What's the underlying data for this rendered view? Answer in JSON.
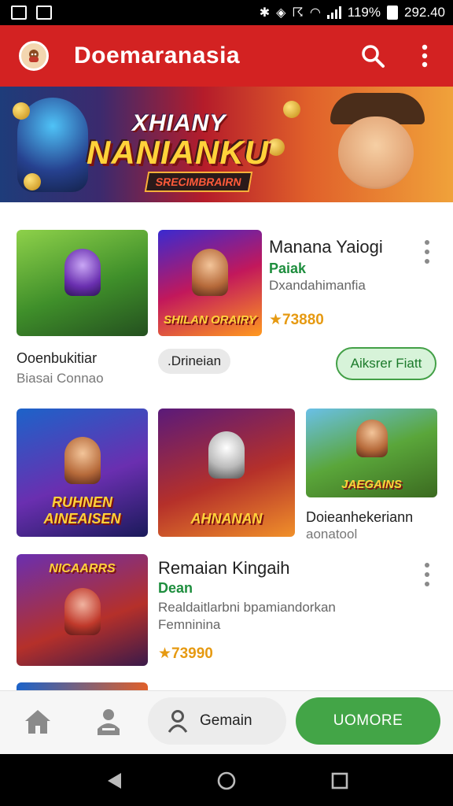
{
  "status_bar": {
    "battery": "119%",
    "time": "292.40",
    "icons": [
      "image-icon",
      "photo-icon",
      "bluetooth-icon",
      "vibrate-icon",
      "nfc-icon",
      "wifi-icon",
      "signal-icon",
      "battery-icon"
    ]
  },
  "app_bar": {
    "title": "Doemaranasia",
    "icons": [
      "avatar-icon",
      "search-icon",
      "more-vert-icon"
    ],
    "accent": "#d32222"
  },
  "hero": {
    "line1": "XHIANY",
    "line2": "NANIANKU",
    "subtitle": "SRECIMBRAIRN"
  },
  "featured": {
    "thumb1_caption_title": "Ooenbukitiar",
    "thumb1_caption_sub": "Biasai Connao",
    "thumb2_overlay": "SHILAN ORAIRY",
    "app_title": "Manana Yaiogi",
    "developer": "Paiak",
    "category": "Dxandahimanfia",
    "rating": "★73880",
    "chip": ".Drineian",
    "install_label": "Aiksrer Fiatt"
  },
  "row2": {
    "thumb1_overlay": "RUHNEN AINEAISEN",
    "thumb2_overlay": "AHNANAN",
    "thumb3_overlay": "JAEGAINS",
    "thumb3_title": "Doieanhekeriann",
    "thumb3_sub": "aonatool"
  },
  "featured2": {
    "thumb_overlay": "NICAARRS",
    "app_title": "Remaian Kingaih",
    "developer": "Dean",
    "description": "Realdaitlarbni bpamiandorkan Femninina",
    "rating": "★73990"
  },
  "bottom_nav": {
    "home_icon": "home-icon",
    "profile_icon": "person-card-icon",
    "pill_label": "Gemain",
    "pill_icon": "person-icon",
    "more_label": "UOMORE",
    "more_color": "#43a547"
  },
  "system_nav": {
    "icons": [
      "back-icon",
      "home-circle-icon",
      "recents-icon"
    ]
  }
}
